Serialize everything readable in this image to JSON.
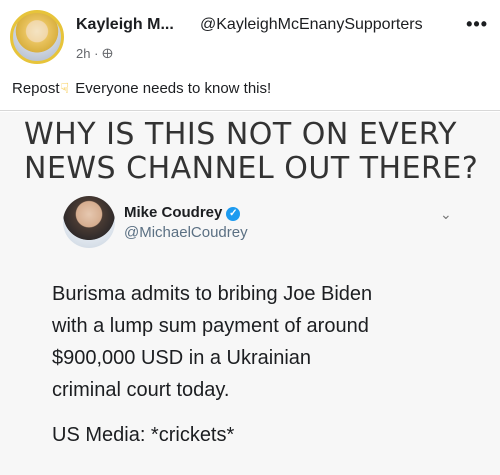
{
  "post": {
    "author_name": "Kayleigh M...",
    "handle": "@KayleighMcEnanySupporters",
    "more_icon": "more-icon",
    "time": "2h",
    "audience_icon": "public-icon",
    "text_prefix": "Repost",
    "emoji": "point-down-icon",
    "text": "Everyone needs to know this!"
  },
  "image": {
    "headline": "WHY IS THIS NOT ON EVERY NEWS CHANNEL OUT THERE?",
    "tweet": {
      "name": "Mike Coudrey",
      "handle": "@MichaelCoudrey",
      "body_lines": [
        "Burisma admits to bribing Joe Biden",
        "with a lump sum payment of around",
        "$900,000 USD in a Ukrainian",
        "criminal court today."
      ],
      "footer": "US Media: *crickets*"
    }
  }
}
